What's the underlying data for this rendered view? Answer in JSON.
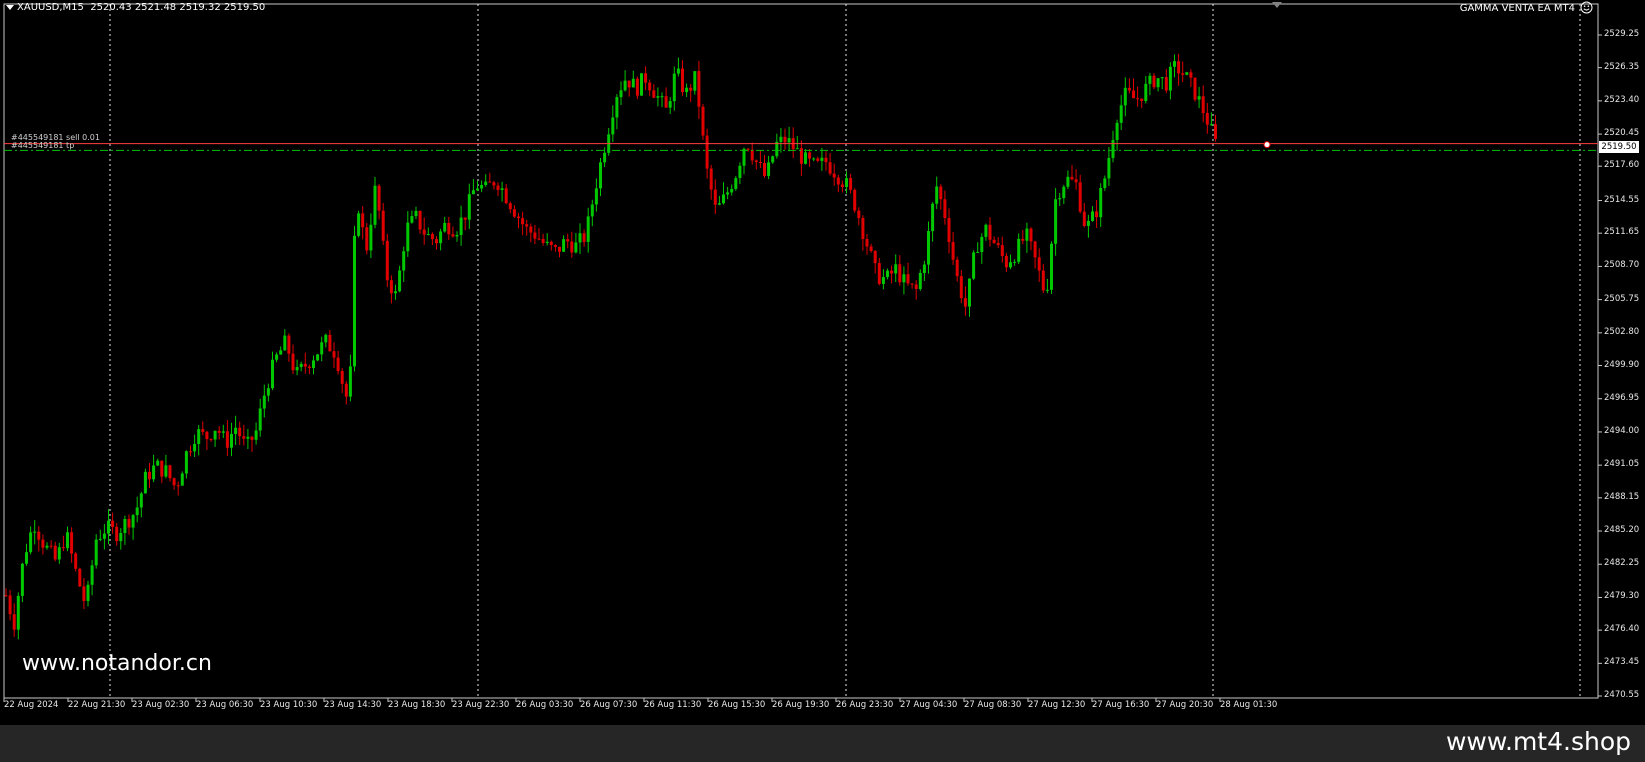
{
  "header": {
    "symbol": "XAUUSD,M15",
    "ohlc": "2520.43 2521.48 2519.32 2519.50",
    "ea_name": "GAMMA VENTA EA MT4"
  },
  "orders": {
    "sell_label": "#445549181 sell 0.01",
    "tp_label": "#445549181 tp"
  },
  "current_price": "2519.50",
  "watermarks": {
    "left": "www.notandor.cn",
    "right": "www.mt4.shop"
  },
  "icons": {
    "menu": "dropdown-triangle-icon",
    "ea_status": "smiley-icon",
    "shift_marker": "chart-shift-triangle-icon"
  },
  "colors": {
    "background": "#000000",
    "bull_candle": "#00c800",
    "bear_candle": "#e00000",
    "sell_line": "#ff4040",
    "tp_line": "#00c000",
    "grid": "#ffffff"
  },
  "chart_data": {
    "type": "candlestick",
    "symbol": "XAUUSD",
    "timeframe": "M15",
    "y_ticks": [
      "2529.25",
      "2526.35",
      "2523.40",
      "2520.45",
      "2517.60",
      "2514.55",
      "2511.65",
      "2508.70",
      "2505.75",
      "2502.80",
      "2499.90",
      "2496.95",
      "2494.00",
      "2491.05",
      "2488.15",
      "2485.20",
      "2482.25",
      "2479.30",
      "2476.40",
      "2473.45",
      "2470.55"
    ],
    "x_ticks": [
      "22 Aug 2024",
      "22 Aug 21:30",
      "23 Aug 02:30",
      "23 Aug 06:30",
      "23 Aug 10:30",
      "23 Aug 14:30",
      "23 Aug 18:30",
      "23 Aug 22:30",
      "26 Aug 03:30",
      "26 Aug 07:30",
      "26 Aug 11:30",
      "26 Aug 15:30",
      "26 Aug 19:30",
      "26 Aug 23:30",
      "27 Aug 04:30",
      "27 Aug 08:30",
      "27 Aug 12:30",
      "27 Aug 16:30",
      "27 Aug 20:30",
      "28 Aug 01:30"
    ],
    "ylim": [
      2470.55,
      2529.25
    ],
    "sell_price": 2519.6,
    "tp_price": 2519.0,
    "grid": "vertical dotted period separators",
    "price_path": [
      [
        0,
        2479.5
      ],
      [
        8,
        2477.0
      ],
      [
        18,
        2483.0
      ],
      [
        28,
        2486.0
      ],
      [
        38,
        2484.0
      ],
      [
        50,
        2482.5
      ],
      [
        60,
        2485.0
      ],
      [
        70,
        2481.5
      ],
      [
        80,
        2478.5
      ],
      [
        90,
        2484.5
      ],
      [
        100,
        2485.5
      ],
      [
        110,
        2485.0
      ],
      [
        120,
        2486.0
      ],
      [
        130,
        2487.0
      ],
      [
        140,
        2490.0
      ],
      [
        150,
        2491.0
      ],
      [
        160,
        2490.5
      ],
      [
        170,
        2489.0
      ],
      [
        180,
        2492.0
      ],
      [
        190,
        2494.0
      ],
      [
        200,
        2493.5
      ],
      [
        210,
        2494.5
      ],
      [
        220,
        2493.0
      ],
      [
        230,
        2494.5
      ],
      [
        240,
        2492.5
      ],
      [
        250,
        2494.0
      ],
      [
        260,
        2498.0
      ],
      [
        270,
        2500.5
      ],
      [
        280,
        2502.0
      ],
      [
        290,
        2499.0
      ],
      [
        300,
        2500.0
      ],
      [
        310,
        2501.0
      ],
      [
        320,
        2502.0
      ],
      [
        330,
        2501.0
      ],
      [
        340,
        2497.0
      ],
      [
        345,
        2499.5
      ],
      [
        350,
        2515.5
      ],
      [
        360,
        2510.0
      ],
      [
        370,
        2516.0
      ],
      [
        380,
        2508.0
      ],
      [
        390,
        2506.0
      ],
      [
        400,
        2512.0
      ],
      [
        410,
        2513.0
      ],
      [
        420,
        2511.5
      ],
      [
        430,
        2511.0
      ],
      [
        440,
        2512.5
      ],
      [
        450,
        2512.0
      ],
      [
        460,
        2513.5
      ],
      [
        470,
        2516.0
      ],
      [
        480,
        2515.5
      ],
      [
        490,
        2516.5
      ],
      [
        500,
        2515.0
      ],
      [
        510,
        2513.5
      ],
      [
        520,
        2512.0
      ],
      [
        530,
        2511.5
      ],
      [
        540,
        2510.5
      ],
      [
        550,
        2510.0
      ],
      [
        560,
        2511.0
      ],
      [
        570,
        2510.5
      ],
      [
        580,
        2511.5
      ],
      [
        590,
        2516.0
      ],
      [
        600,
        2520.0
      ],
      [
        610,
        2524.0
      ],
      [
        620,
        2525.5
      ],
      [
        630,
        2524.5
      ],
      [
        640,
        2525.5
      ],
      [
        650,
        2524.0
      ],
      [
        660,
        2522.5
      ],
      [
        670,
        2526.0
      ],
      [
        680,
        2524.0
      ],
      [
        690,
        2525.5
      ],
      [
        700,
        2517.5
      ],
      [
        710,
        2513.5
      ],
      [
        720,
        2515.0
      ],
      [
        730,
        2517.0
      ],
      [
        740,
        2520.0
      ],
      [
        750,
        2518.0
      ],
      [
        760,
        2516.5
      ],
      [
        770,
        2519.5
      ],
      [
        780,
        2520.0
      ],
      [
        790,
        2519.0
      ],
      [
        800,
        2518.0
      ],
      [
        810,
        2517.5
      ],
      [
        820,
        2518.0
      ],
      [
        830,
        2517.0
      ],
      [
        840,
        2516.0
      ],
      [
        850,
        2514.0
      ],
      [
        860,
        2511.0
      ],
      [
        870,
        2508.0
      ],
      [
        880,
        2507.5
      ],
      [
        890,
        2508.5
      ],
      [
        900,
        2507.0
      ],
      [
        910,
        2506.5
      ],
      [
        920,
        2510.0
      ],
      [
        930,
        2516.0
      ],
      [
        940,
        2513.0
      ],
      [
        950,
        2508.0
      ],
      [
        960,
        2505.0
      ],
      [
        970,
        2510.5
      ],
      [
        980,
        2512.0
      ],
      [
        990,
        2510.5
      ],
      [
        1000,
        2509.0
      ],
      [
        1010,
        2510.0
      ],
      [
        1020,
        2511.5
      ],
      [
        1030,
        2509.0
      ],
      [
        1040,
        2506.0
      ],
      [
        1050,
        2515.0
      ],
      [
        1060,
        2516.5
      ],
      [
        1070,
        2516.0
      ],
      [
        1080,
        2512.0
      ],
      [
        1090,
        2513.5
      ],
      [
        1100,
        2517.0
      ],
      [
        1110,
        2522.0
      ],
      [
        1120,
        2524.0
      ],
      [
        1130,
        2523.5
      ],
      [
        1140,
        2524.5
      ],
      [
        1150,
        2525.5
      ],
      [
        1160,
        2525.0
      ],
      [
        1170,
        2526.5
      ],
      [
        1180,
        2525.5
      ],
      [
        1190,
        2524.0
      ],
      [
        1200,
        2522.0
      ],
      [
        1210,
        2519.5
      ]
    ]
  }
}
